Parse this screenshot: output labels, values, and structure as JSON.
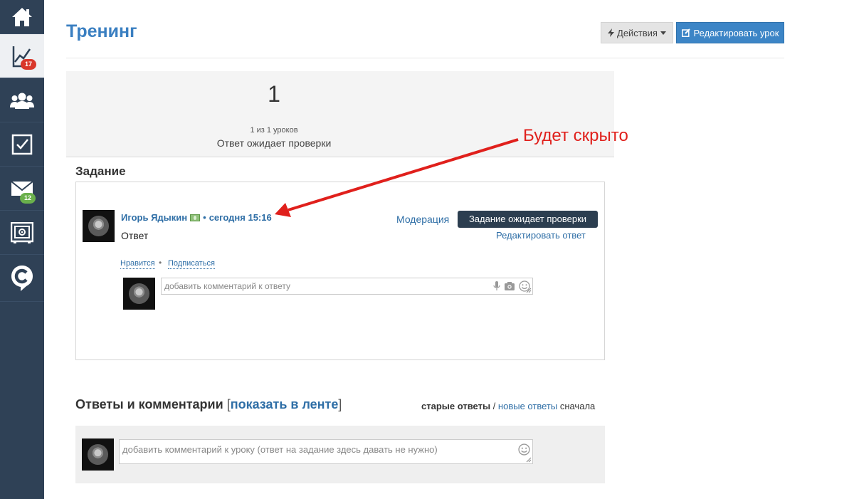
{
  "sidebar": {
    "items": [
      {
        "name": "home",
        "icon": "home-icon",
        "badge": ""
      },
      {
        "name": "stats",
        "icon": "chart-icon",
        "badge": "17",
        "badge_color": "#d9372b"
      },
      {
        "name": "users",
        "icon": "users-icon",
        "badge": ""
      },
      {
        "name": "tasks",
        "icon": "checkbox-icon",
        "badge": ""
      },
      {
        "name": "messages",
        "icon": "envelope-icon",
        "badge": "12",
        "badge_color": "#6ab04c"
      },
      {
        "name": "settings",
        "icon": "safe-icon",
        "badge": ""
      },
      {
        "name": "brand",
        "icon": "c-logo-icon",
        "badge": ""
      }
    ]
  },
  "header": {
    "title": "Тренинг",
    "actions_label": "Действия",
    "edit_label": "Редактировать урок"
  },
  "lesson": {
    "number": "1",
    "count": "1 из 1 уроков",
    "status": "Ответ ожидает проверки"
  },
  "annotation": {
    "text": "Будет скрыто",
    "color": "#e0201c"
  },
  "task": {
    "heading": "Задание",
    "author": "Игорь Ядыкин",
    "separator": "•",
    "time": "сегодня 15:16",
    "answer": "Ответ",
    "moderation": "Модерация",
    "status_badge": "Задание ожидает проверки",
    "edit_answer": "Редактировать ответ",
    "like": "Нравится",
    "dot": "•",
    "subscribe": "Подписаться",
    "comment_placeholder": "добавить комментарий к ответу"
  },
  "answers": {
    "heading": "Ответы и комментарии",
    "bracket_open": "[",
    "show_feed": "показать в ленте",
    "bracket_close": "]",
    "sort_old": "старые ответы",
    "sort_sep": "/",
    "sort_new": "новые ответы",
    "sort_suffix": "сначала",
    "comment_placeholder": "добавить комментарий к уроку (ответ на задание здесь давать не нужно)"
  },
  "colors": {
    "sidebar": "#2f4156",
    "accent": "#3a7fc1",
    "link": "#2e6ea6",
    "status_dark": "#2c3e50"
  }
}
